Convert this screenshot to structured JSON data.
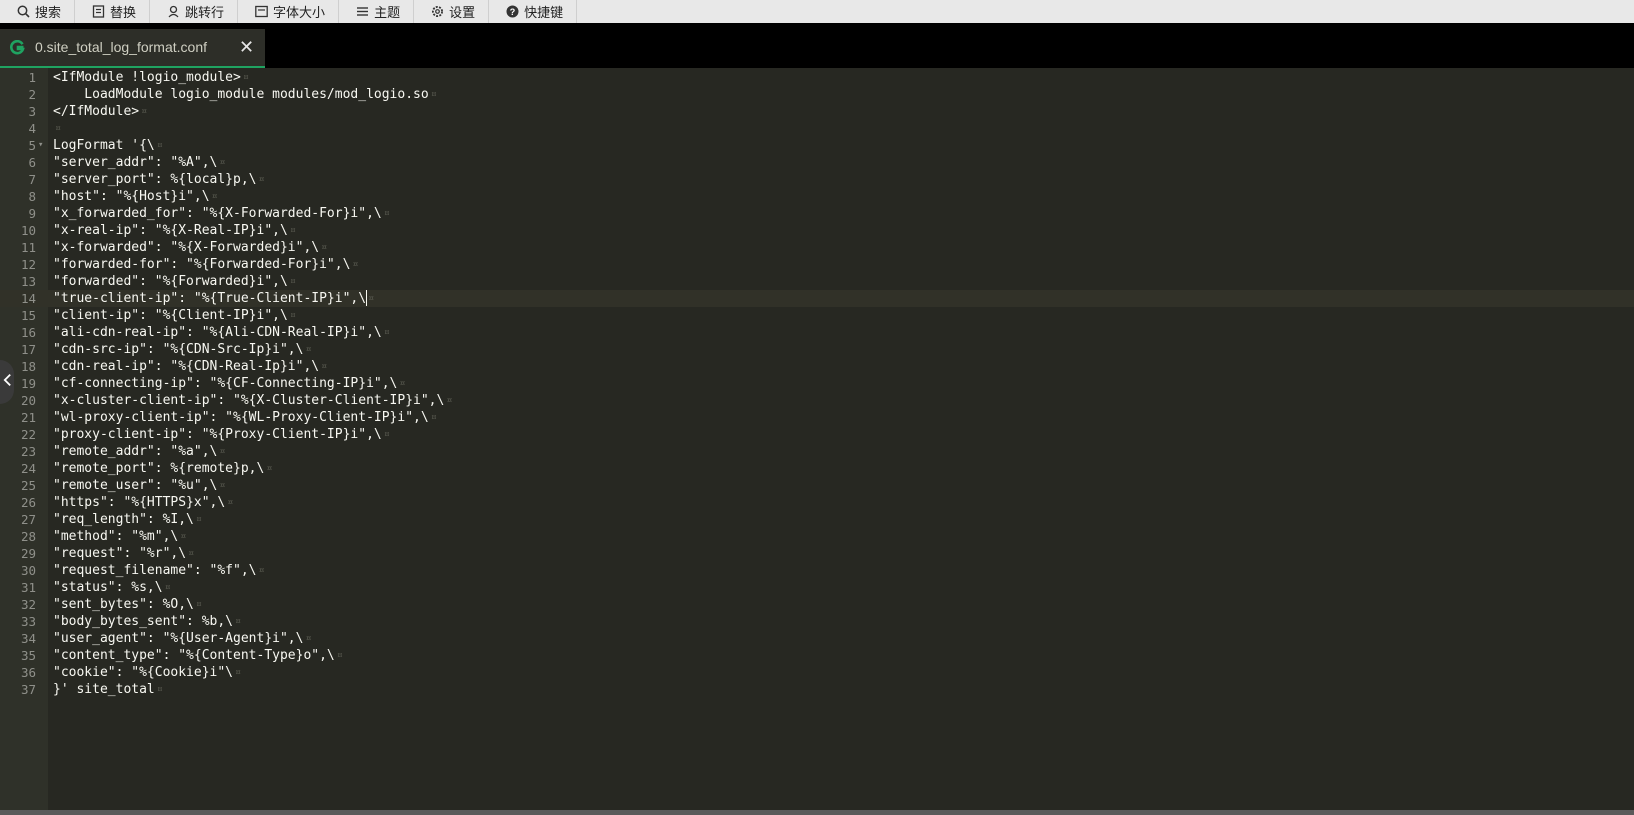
{
  "toolbar": {
    "buttons": [
      {
        "label": "搜索",
        "icon": "search-icon"
      },
      {
        "label": "替换",
        "icon": "replace-icon"
      },
      {
        "label": "跳转行",
        "icon": "goto-line-icon"
      },
      {
        "label": "字体大小",
        "icon": "font-size-icon"
      },
      {
        "label": "主题",
        "icon": "theme-icon"
      },
      {
        "label": "设置",
        "icon": "gear-icon"
      },
      {
        "label": "快捷键",
        "icon": "help-icon"
      }
    ]
  },
  "tab": {
    "title": "0.site_total_log_format.conf",
    "close": "✕",
    "icon": "file-icon",
    "icon_color": "#1fa361"
  },
  "editor": {
    "active_line": 14,
    "fold_marker": "▾",
    "lines": [
      "<IfModule !logio_module>",
      "    LoadModule logio_module modules/mod_logio.so",
      "</IfModule>",
      "",
      "LogFormat '{\\",
      "\"server_addr\": \"%A\",\\",
      "\"server_port\": %{local}p,\\",
      "\"host\": \"%{Host}i\",\\",
      "\"x_forwarded_for\": \"%{X-Forwarded-For}i\",\\",
      "\"x-real-ip\": \"%{X-Real-IP}i\",\\",
      "\"x-forwarded\": \"%{X-Forwarded}i\",\\",
      "\"forwarded-for\": \"%{Forwarded-For}i\",\\",
      "\"forwarded\": \"%{Forwarded}i\",\\",
      "\"true-client-ip\": \"%{True-Client-IP}i\",\\",
      "\"client-ip\": \"%{Client-IP}i\",\\",
      "\"ali-cdn-real-ip\": \"%{Ali-CDN-Real-IP}i\",\\",
      "\"cdn-src-ip\": \"%{CDN-Src-Ip}i\",\\",
      "\"cdn-real-ip\": \"%{CDN-Real-Ip}i\",\\",
      "\"cf-connecting-ip\": \"%{CF-Connecting-IP}i\",\\",
      "\"x-cluster-client-ip\": \"%{X-Cluster-Client-IP}i\",\\",
      "\"wl-proxy-client-ip\": \"%{WL-Proxy-Client-IP}i\",\\",
      "\"proxy-client-ip\": \"%{Proxy-Client-IP}i\",\\",
      "\"remote_addr\": \"%a\",\\",
      "\"remote_port\": %{remote}p,\\",
      "\"remote_user\": \"%u\",\\",
      "\"https\": \"%{HTTPS}x\",\\",
      "\"req_length\": %I,\\",
      "\"method\": \"%m\",\\",
      "\"request\": \"%r\",\\",
      "\"request_filename\": \"%f\",\\",
      "\"status\": %s,\\",
      "\"sent_bytes\": %O,\\",
      "\"body_bytes_sent\": %b,\\",
      "\"user_agent\": \"%{User-Agent}i\",\\",
      "\"content_type\": \"%{Content-Type}o\",\\",
      "\"cookie\": \"%{Cookie}i\"\\",
      "}' site_total"
    ],
    "line_numbers": [
      "1",
      "2",
      "3",
      "4",
      "5",
      "6",
      "7",
      "8",
      "9",
      "10",
      "11",
      "12",
      "13",
      "14",
      "15",
      "16",
      "17",
      "18",
      "19",
      "20",
      "21",
      "22",
      "23",
      "24",
      "25",
      "26",
      "27",
      "28",
      "29",
      "30",
      "31",
      "32",
      "33",
      "34",
      "35",
      "36",
      "37"
    ]
  },
  "colors": {
    "background": "#272822",
    "gutter": "#2f3129",
    "text": "#f8f8f2",
    "line_number": "#8f908a",
    "toolbar": "#e8e8e8",
    "tab_accent": "#1fa361"
  }
}
